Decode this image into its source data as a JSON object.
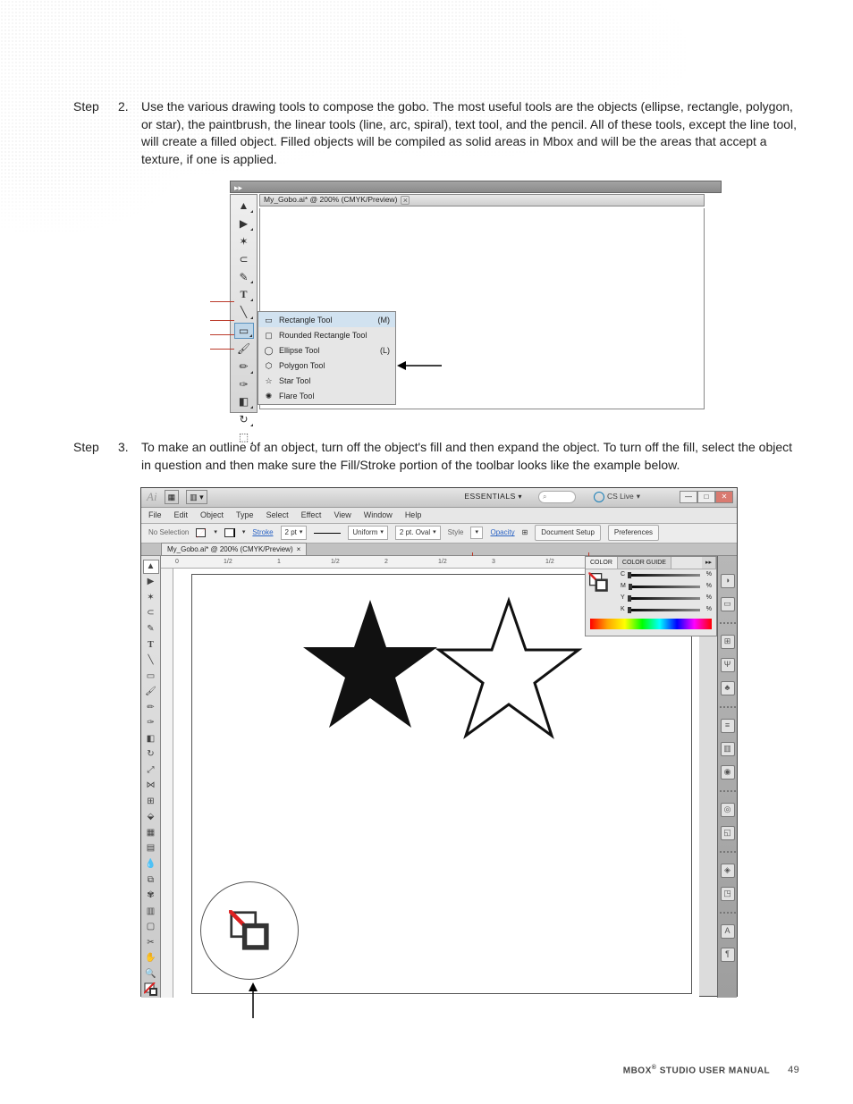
{
  "steps": [
    {
      "label": "Step",
      "num": "2.",
      "text": "Use the various drawing tools to compose the gobo. The most useful tools are the objects (ellipse, rectangle, polygon, or star), the paintbrush, the linear tools (line, arc, spiral), text tool, and the pencil. All of these tools, except the line tool, will create a filled object. Filled objects will be compiled as solid areas in Mbox and will be the areas that accept a texture, if one is applied."
    },
    {
      "label": "Step",
      "num": "3.",
      "text": "To make an outline of an object, turn off the object's fill and then expand the object. To turn off the fill, select the object in question and then make sure the Fill/Stroke portion of the toolbar looks like the example below."
    }
  ],
  "fig1": {
    "tab_title": "My_Gobo.ai* @ 200% (CMYK/Preview)",
    "flyout": [
      {
        "label": "Rectangle Tool",
        "shortcut": "(M)",
        "selected": true
      },
      {
        "label": "Rounded Rectangle Tool",
        "shortcut": ""
      },
      {
        "label": "Ellipse Tool",
        "shortcut": "(L)"
      },
      {
        "label": "Polygon Tool",
        "shortcut": ""
      },
      {
        "label": "Star Tool",
        "shortcut": ""
      },
      {
        "label": "Flare Tool",
        "shortcut": ""
      }
    ]
  },
  "fig2": {
    "workspace": "ESSENTIALS",
    "cslive": "CS Live",
    "menus": [
      "File",
      "Edit",
      "Object",
      "Type",
      "Select",
      "Effect",
      "View",
      "Window",
      "Help"
    ],
    "ctrl": {
      "selection": "No Selection",
      "stroke_label": "Stroke",
      "stroke_val": "2 pt",
      "brush": "Uniform",
      "shape": "2 pt. Oval",
      "style_label": "Style",
      "opacity_label": "Opacity",
      "docsetup": "Document Setup",
      "prefs": "Preferences"
    },
    "tab_title": "My_Gobo.ai* @ 200% (CMYK/Preview)",
    "ruler_marks": [
      "0",
      "1/2",
      "1",
      "1/2",
      "2",
      "1/2",
      "3",
      "1/2"
    ],
    "color_panel": {
      "tab_a": "COLOR",
      "tab_b": "COLOR GUIDE",
      "channels": [
        "C",
        "M",
        "Y",
        "K"
      ],
      "pct": "%"
    }
  },
  "footer": {
    "title_a": "MBOX",
    "title_b": "STUDIO USER MANUAL",
    "page": "49"
  }
}
